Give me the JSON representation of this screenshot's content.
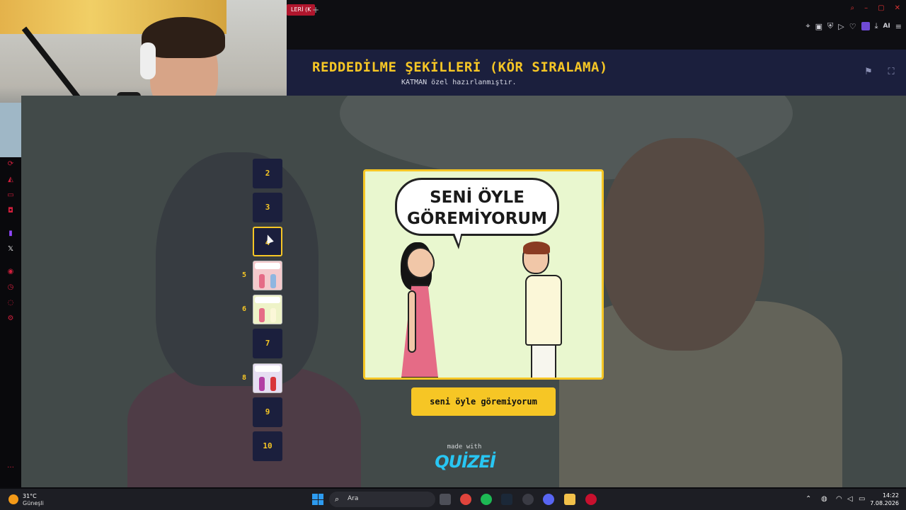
{
  "browser": {
    "tab_label": "LERİ (K",
    "new_tab": "+",
    "toolbar_ai": "AI"
  },
  "app": {
    "title": "REDDEDİLME ŞEKİLLERİ (KÖR SIRALAMA)",
    "subtitle": "KATMAN özel hazırlanmıştır."
  },
  "ranking": {
    "slots": [
      {
        "label": "2",
        "filled": false
      },
      {
        "label": "3",
        "filled": false
      },
      {
        "label": "4",
        "filled": false,
        "active": true
      },
      {
        "label": "5",
        "filled": true,
        "thumb_title": "ARKADAŞIM OLARAK GÖRÜYORUM"
      },
      {
        "label": "6",
        "filled": true,
        "thumb_title": "SENİ ÖYLE GÖREMİYORUM"
      },
      {
        "label": "7",
        "filled": false
      },
      {
        "label": "8",
        "filled": true,
        "thumb_title": "SEN DEĞİLSİN BEN"
      },
      {
        "label": "9",
        "filled": false
      },
      {
        "label": "10",
        "filled": false
      }
    ]
  },
  "card": {
    "speech_text": "SENİ ÖYLE\nGÖREMİYORUM",
    "answer_label": "seni öyle göremiyorum"
  },
  "footer": {
    "made_with": "made with",
    "brand": "QUİZEİ"
  },
  "taskbar": {
    "weather_temp": "31°C",
    "weather_desc": "Güneşli",
    "search_placeholder": "Ara",
    "time": "14:22",
    "date": "7.08.2026"
  },
  "colors": {
    "accent": "#f6c625",
    "header_bg": "#1b1f3d",
    "card_bg": "#e9f7cf",
    "brand": "#28c6f3"
  }
}
